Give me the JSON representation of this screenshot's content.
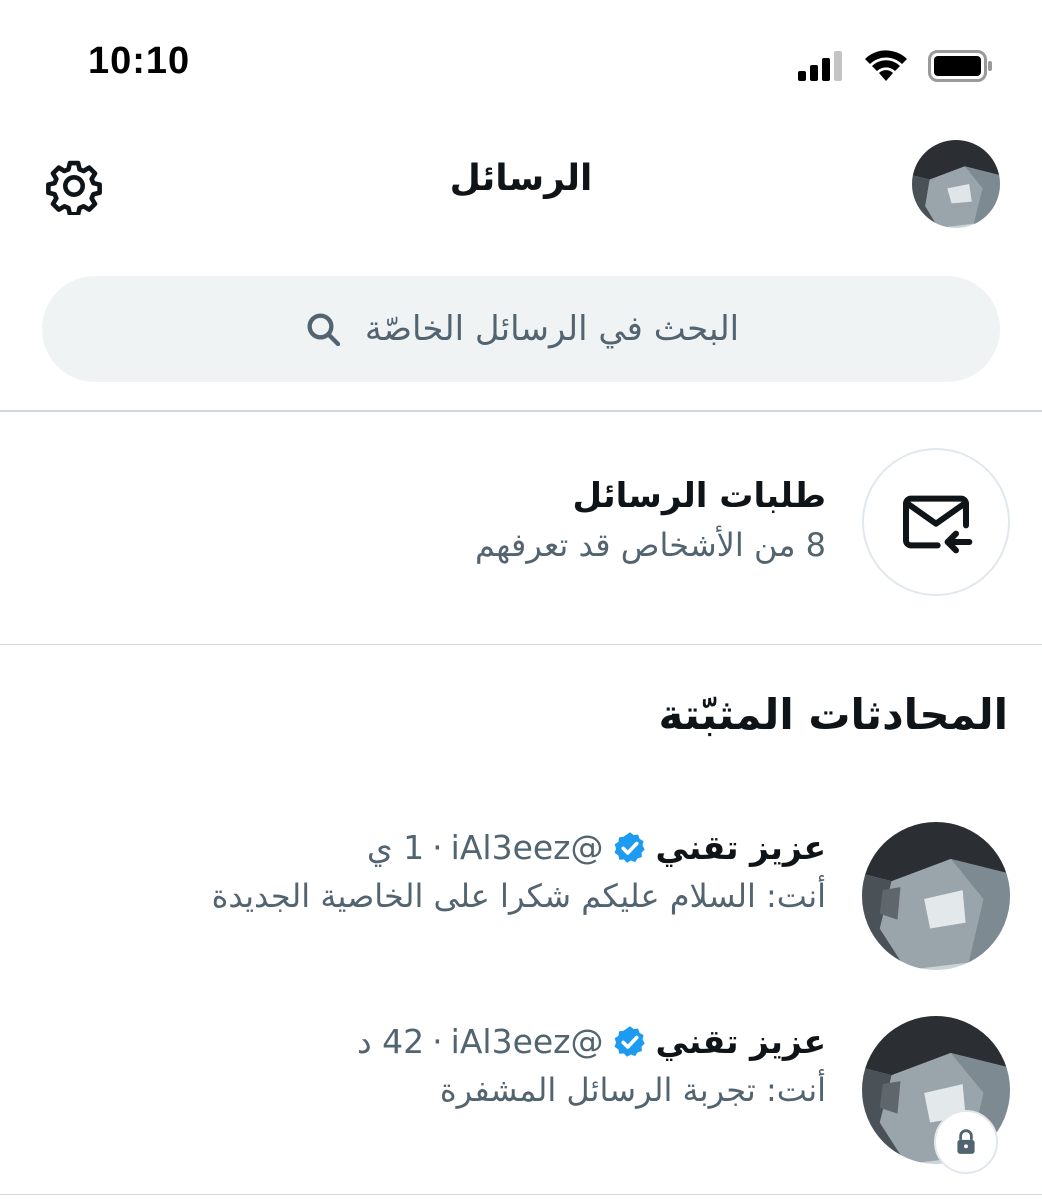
{
  "status_bar": {
    "time": "10:10"
  },
  "header": {
    "title": "الرسائل"
  },
  "search": {
    "placeholder": "البحث في الرسائل الخاصّة"
  },
  "requests": {
    "title": "طلبات الرسائل",
    "subtitle": "8 من الأشخاص قد تعرفهم"
  },
  "pinned": {
    "section_title": "المحادثات المثبّتة",
    "items": [
      {
        "name": "عزيز تقني",
        "handle": "@iAl3eez",
        "separator": "·",
        "time": "1 ي",
        "preview": "أنت: السلام عليكم شكرا على الخاصية الجديدة",
        "encrypted": false
      },
      {
        "name": "عزيز تقني",
        "handle": "@iAl3eez",
        "separator": "·",
        "time": "42 د",
        "preview": "أنت: تجربة الرسائل المشفرة",
        "encrypted": true
      }
    ]
  },
  "icons": {
    "settings": "gear-icon",
    "search": "search-icon",
    "requests": "envelope-arrow-icon",
    "verified": "verified-badge-icon",
    "lock": "lock-icon"
  },
  "colors": {
    "verified": "#1d9bf0",
    "secondary_text": "#536471",
    "search_bg": "#eff3f4"
  }
}
